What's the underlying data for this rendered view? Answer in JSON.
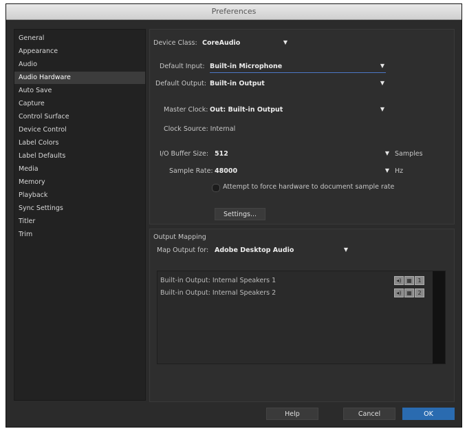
{
  "window": {
    "title": "Preferences"
  },
  "sidebar": {
    "items": [
      {
        "label": "General",
        "selected": false
      },
      {
        "label": "Appearance",
        "selected": false
      },
      {
        "label": "Audio",
        "selected": false
      },
      {
        "label": "Audio Hardware",
        "selected": true
      },
      {
        "label": "Auto Save",
        "selected": false
      },
      {
        "label": "Capture",
        "selected": false
      },
      {
        "label": "Control Surface",
        "selected": false
      },
      {
        "label": "Device Control",
        "selected": false
      },
      {
        "label": "Label Colors",
        "selected": false
      },
      {
        "label": "Label Defaults",
        "selected": false
      },
      {
        "label": "Media",
        "selected": false
      },
      {
        "label": "Memory",
        "selected": false
      },
      {
        "label": "Playback",
        "selected": false
      },
      {
        "label": "Sync Settings",
        "selected": false
      },
      {
        "label": "Titler",
        "selected": false
      },
      {
        "label": "Trim",
        "selected": false
      }
    ]
  },
  "hardware": {
    "device_class_label": "Device Class:",
    "device_class_value": "CoreAudio",
    "default_input_label": "Default Input:",
    "default_input_value": "Built-in Microphone",
    "default_output_label": "Default Output:",
    "default_output_value": "Built-in Output",
    "master_clock_label": "Master Clock:",
    "master_clock_value": "Out: Built-in Output",
    "clock_source_text": "Clock Source: Internal",
    "buffer_label": "I/O Buffer Size:",
    "buffer_value": "512",
    "buffer_unit": "Samples",
    "sample_rate_label": "Sample Rate:",
    "sample_rate_value": "48000",
    "sample_rate_unit": "Hz",
    "force_checkbox_label": "Attempt to force hardware to document sample rate",
    "settings_button": "Settings..."
  },
  "mapping": {
    "section_title": "Output Mapping",
    "map_output_label": "Map Output for:",
    "map_output_value": "Adobe Desktop Audio",
    "rows": [
      {
        "text": "Built-in Output: Internal Speakers 1",
        "channel": "1"
      },
      {
        "text": "Built-in Output: Internal Speakers 2",
        "channel": "2"
      }
    ]
  },
  "footer": {
    "help": "Help",
    "cancel": "Cancel",
    "ok": "OK"
  },
  "colors": {
    "accent": "#2a6bb0",
    "background": "#2b2b2b"
  }
}
